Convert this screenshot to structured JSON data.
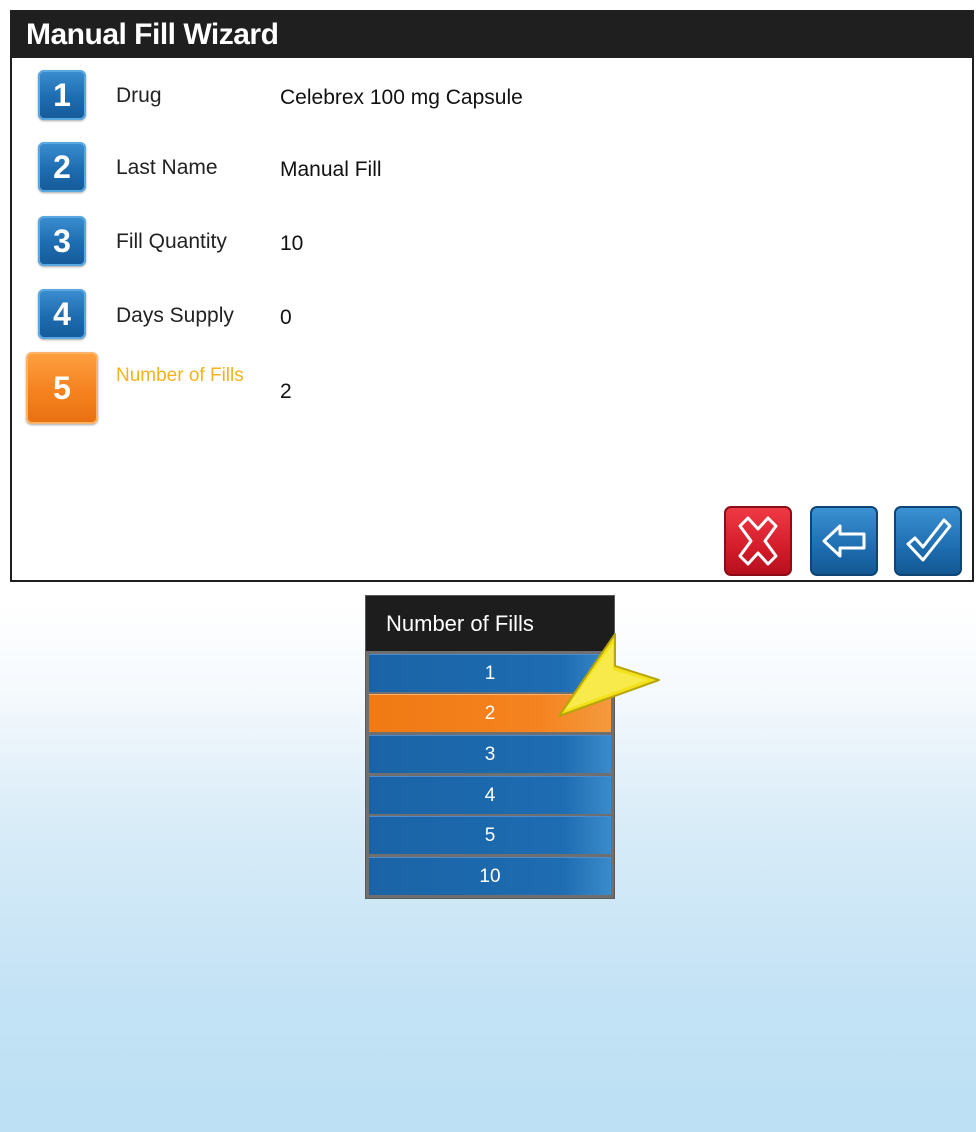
{
  "wizard": {
    "title": "Manual Fill Wizard",
    "steps": [
      {
        "number": "1",
        "label": "Drug",
        "value": "Celebrex 100 mg Capsule"
      },
      {
        "number": "2",
        "label": "Last Name",
        "value": "Manual Fill"
      },
      {
        "number": "3",
        "label": "Fill Quantity",
        "value": "10"
      },
      {
        "number": "4",
        "label": "Days Supply",
        "value": "0"
      },
      {
        "number": "5",
        "label": "Number of Fills",
        "value": "2"
      }
    ],
    "active_step": 5,
    "buttons": {
      "cancel_icon": "x-icon",
      "back_icon": "back-arrow-icon",
      "confirm_icon": "checkmark-icon"
    }
  },
  "fills_picker": {
    "title": "Number of Fills",
    "options": [
      "1",
      "2",
      "3",
      "4",
      "5",
      "10"
    ],
    "selected": "2"
  },
  "colors": {
    "step_blue": "#1e6cb0",
    "step_active_orange": "#f5821f",
    "active_label": "#f4b21e",
    "cancel_red": "#d41c2a",
    "pointer_yellow": "#f3e21a"
  }
}
